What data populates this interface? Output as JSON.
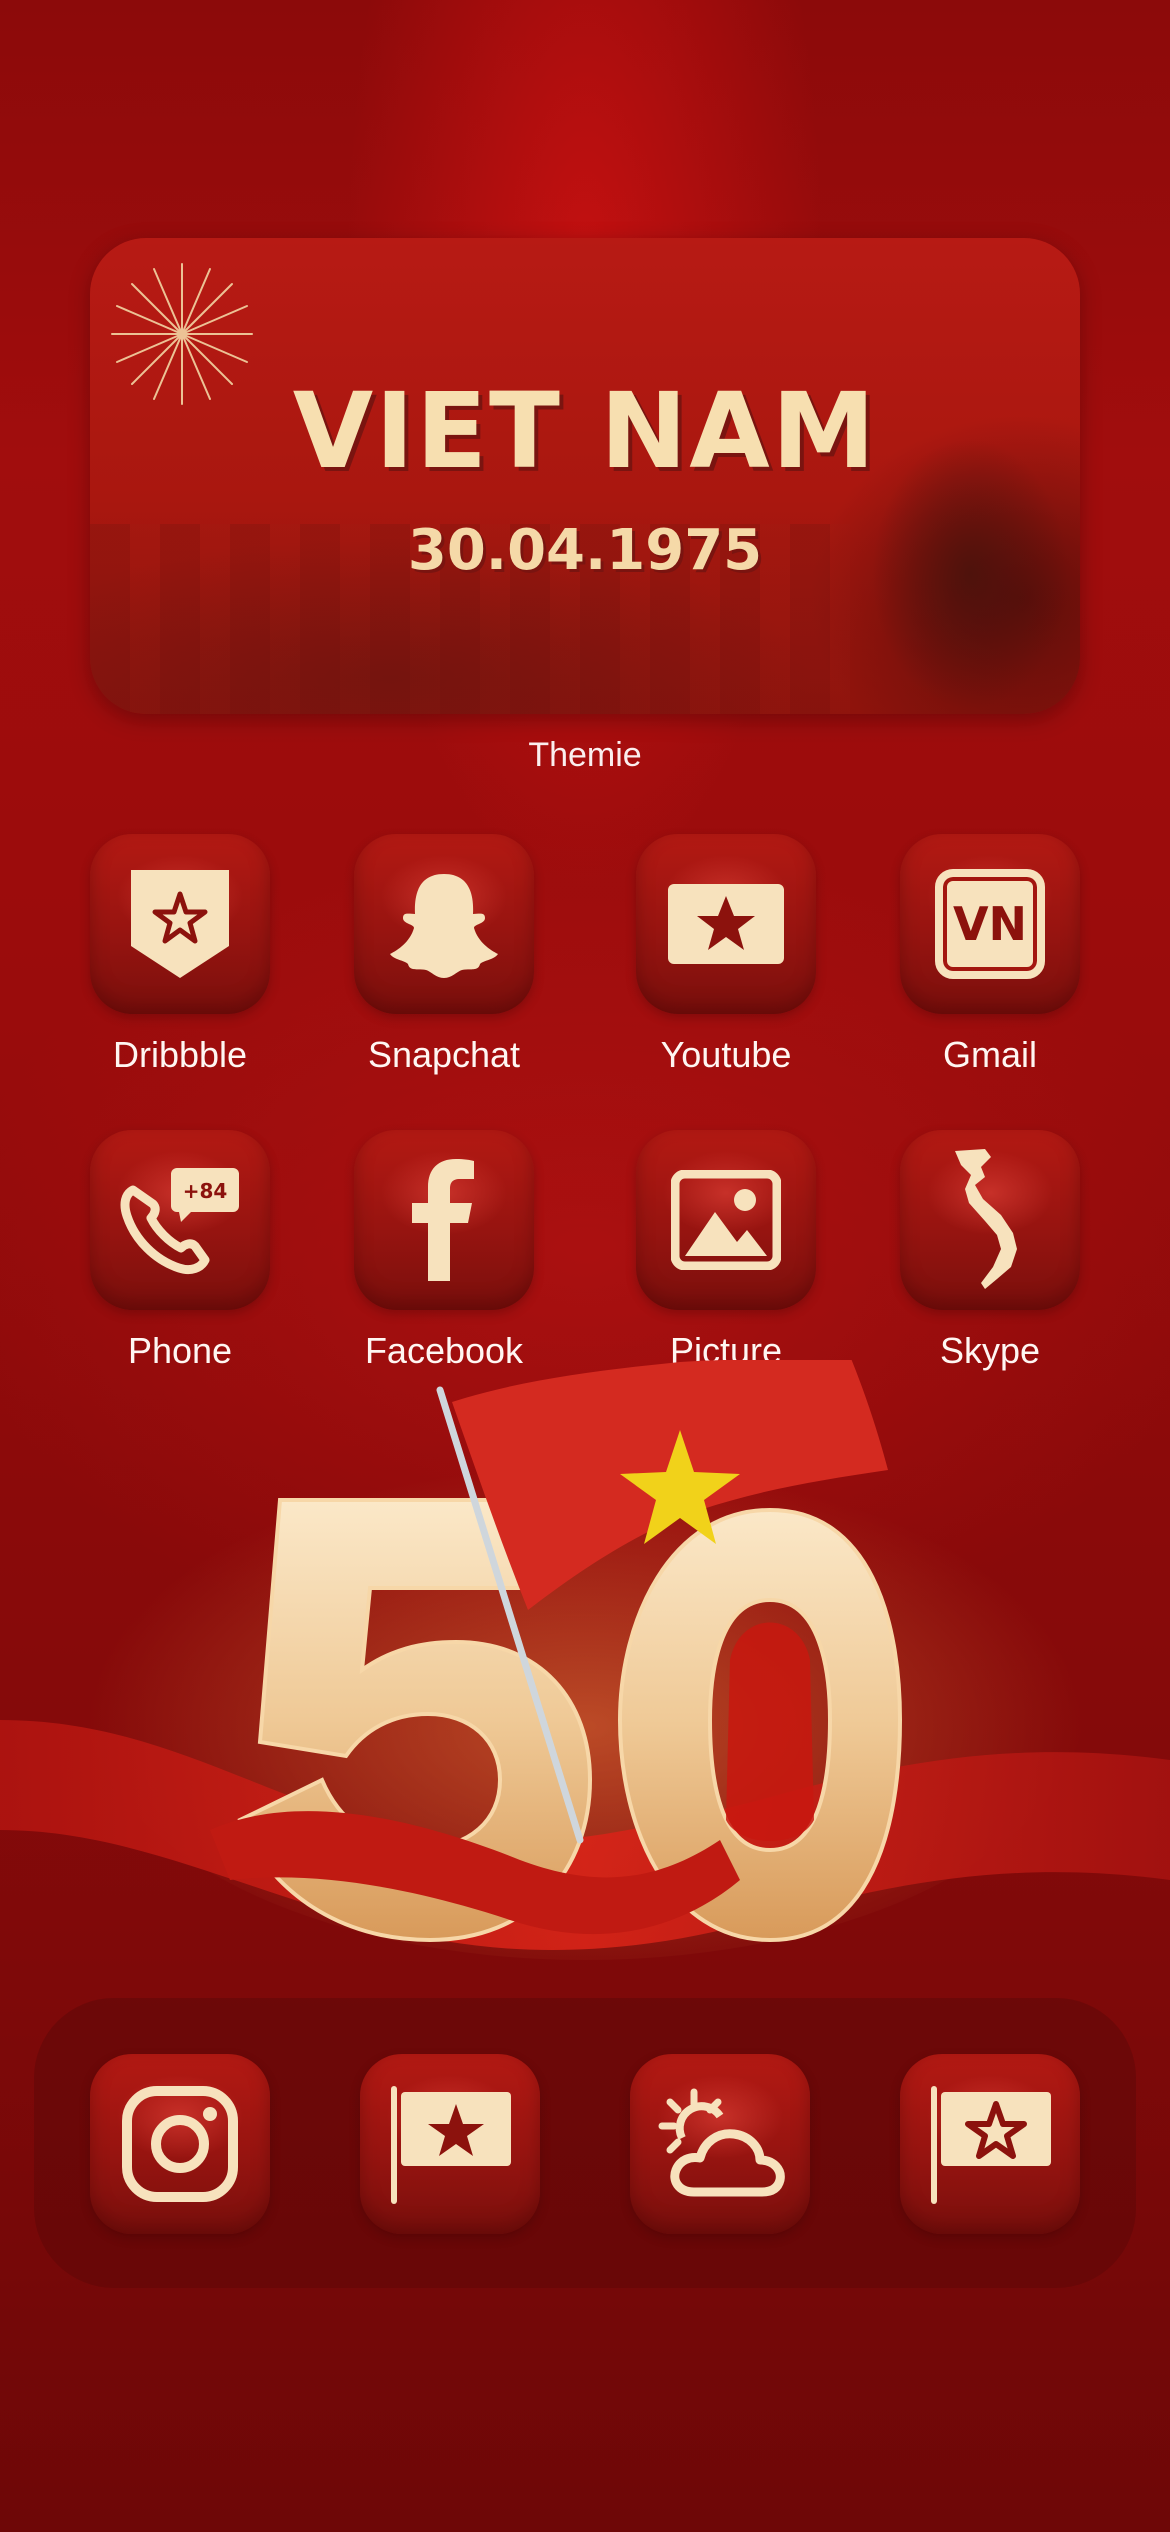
{
  "widget": {
    "title": "VIET NAM",
    "date": "30.04.1975",
    "label": "Themie"
  },
  "apps": [
    {
      "label": "Dribbble",
      "icon": "flag-star-pennant-icon"
    },
    {
      "label": "Snapchat",
      "icon": "ghost-icon"
    },
    {
      "label": "Youtube",
      "icon": "flag-star-icon"
    },
    {
      "label": "Gmail",
      "icon": "vn-badge-icon"
    },
    {
      "label": "Phone",
      "icon": "phone-icon"
    },
    {
      "label": "Facebook",
      "icon": "facebook-icon"
    },
    {
      "label": "Picture",
      "icon": "picture-icon"
    },
    {
      "label": "Skype",
      "icon": "vietnam-map-icon"
    }
  ],
  "phone_badge": "+84",
  "gmail_badge": "VN",
  "dock": [
    {
      "icon": "instagram-icon"
    },
    {
      "icon": "flag-pole-star-icon"
    },
    {
      "icon": "weather-sun-cloud-icon"
    },
    {
      "icon": "flag-pole-star-outline-icon"
    }
  ],
  "artwork": {
    "number": "50"
  },
  "colors": {
    "background": "#9a0c0c",
    "tile": "#a8170f",
    "cream": "#f7e2bd",
    "flag_red": "#d42a20",
    "flag_star": "#f1d21a"
  }
}
